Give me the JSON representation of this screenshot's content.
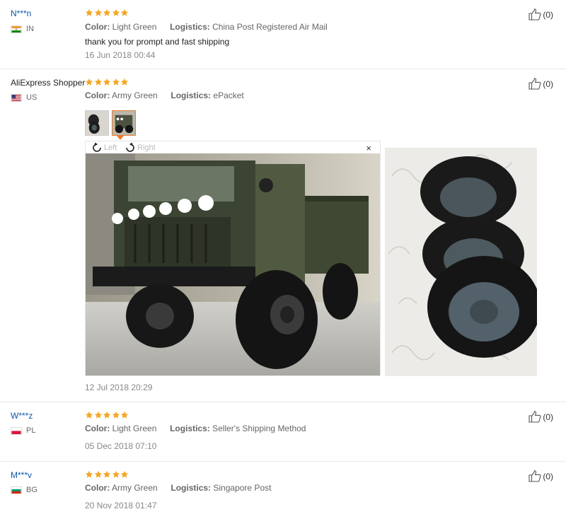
{
  "reviews": [
    {
      "name": "N***n",
      "country": "IN",
      "stars": 5,
      "color_label": "Color:",
      "color_value": "Light Green",
      "logistics_label": "Logistics:",
      "logistics_value": "China Post Registered Air Mail",
      "text": "thank you for prompt and fast shipping",
      "date": "16 Jun 2018 00:44",
      "helpful": "(0)"
    },
    {
      "name": "AliExpress Shopper",
      "country": "US",
      "stars": 5,
      "color_label": "Color:",
      "color_value": "Army Green",
      "logistics_label": "Logistics:",
      "logistics_value": "ePacket",
      "date": "12 Jul 2018 20:29",
      "helpful": "(0)",
      "viewer": {
        "rotate_left": "Left",
        "rotate_right": "Right",
        "close": "×"
      }
    },
    {
      "name": "W***z",
      "country": "PL",
      "stars": 5,
      "color_label": "Color:",
      "color_value": "Light Green",
      "logistics_label": "Logistics:",
      "logistics_value": "Seller's Shipping Method",
      "date": "05 Dec 2018 07:10",
      "helpful": "(0)"
    },
    {
      "name": "M***v",
      "country": "BG",
      "stars": 5,
      "color_label": "Color:",
      "color_value": "Army Green",
      "logistics_label": "Logistics:",
      "logistics_value": "Singapore Post",
      "date": "20 Nov 2018 01:47",
      "helpful": "(0)"
    }
  ],
  "colors": {
    "star": "#f5a623",
    "link_name": "#0a58a6",
    "active_thumb_border": "#e87a2c"
  },
  "icons": {
    "rating": "star-icon",
    "helpful": "thumbs-up-icon",
    "rotate_left": "rotate-left-icon",
    "rotate_right": "rotate-right-icon",
    "close": "close-icon"
  }
}
